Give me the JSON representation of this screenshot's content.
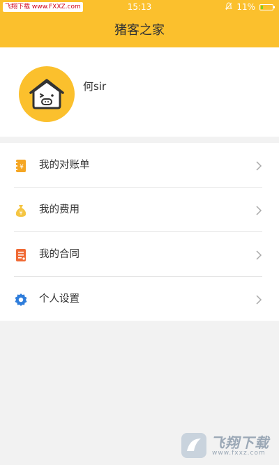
{
  "status_bar": {
    "watermark": "飞翔下载 www.FXXZ.com",
    "time": "15:13",
    "battery_percent": "11%",
    "battery_level": 0.11
  },
  "header": {
    "title": "猪客之家",
    "background_color": "#fbc02d"
  },
  "profile": {
    "avatar_icon": "pig-house-icon",
    "name": "何sir"
  },
  "menu": {
    "items": [
      {
        "label": "我的对账单",
        "icon": "statement-icon",
        "icon_color": "#f5a623"
      },
      {
        "label": "我的费用",
        "icon": "money-bag-icon",
        "icon_color": "#f5c542"
      },
      {
        "label": "我的合同",
        "icon": "contract-icon",
        "icon_color": "#f06a35"
      },
      {
        "label": "个人设置",
        "icon": "gear-icon",
        "icon_color": "#2f7ddb"
      }
    ]
  },
  "watermark_bottom": {
    "brand": "飞翔下载",
    "url": "www.fxxz.com"
  }
}
